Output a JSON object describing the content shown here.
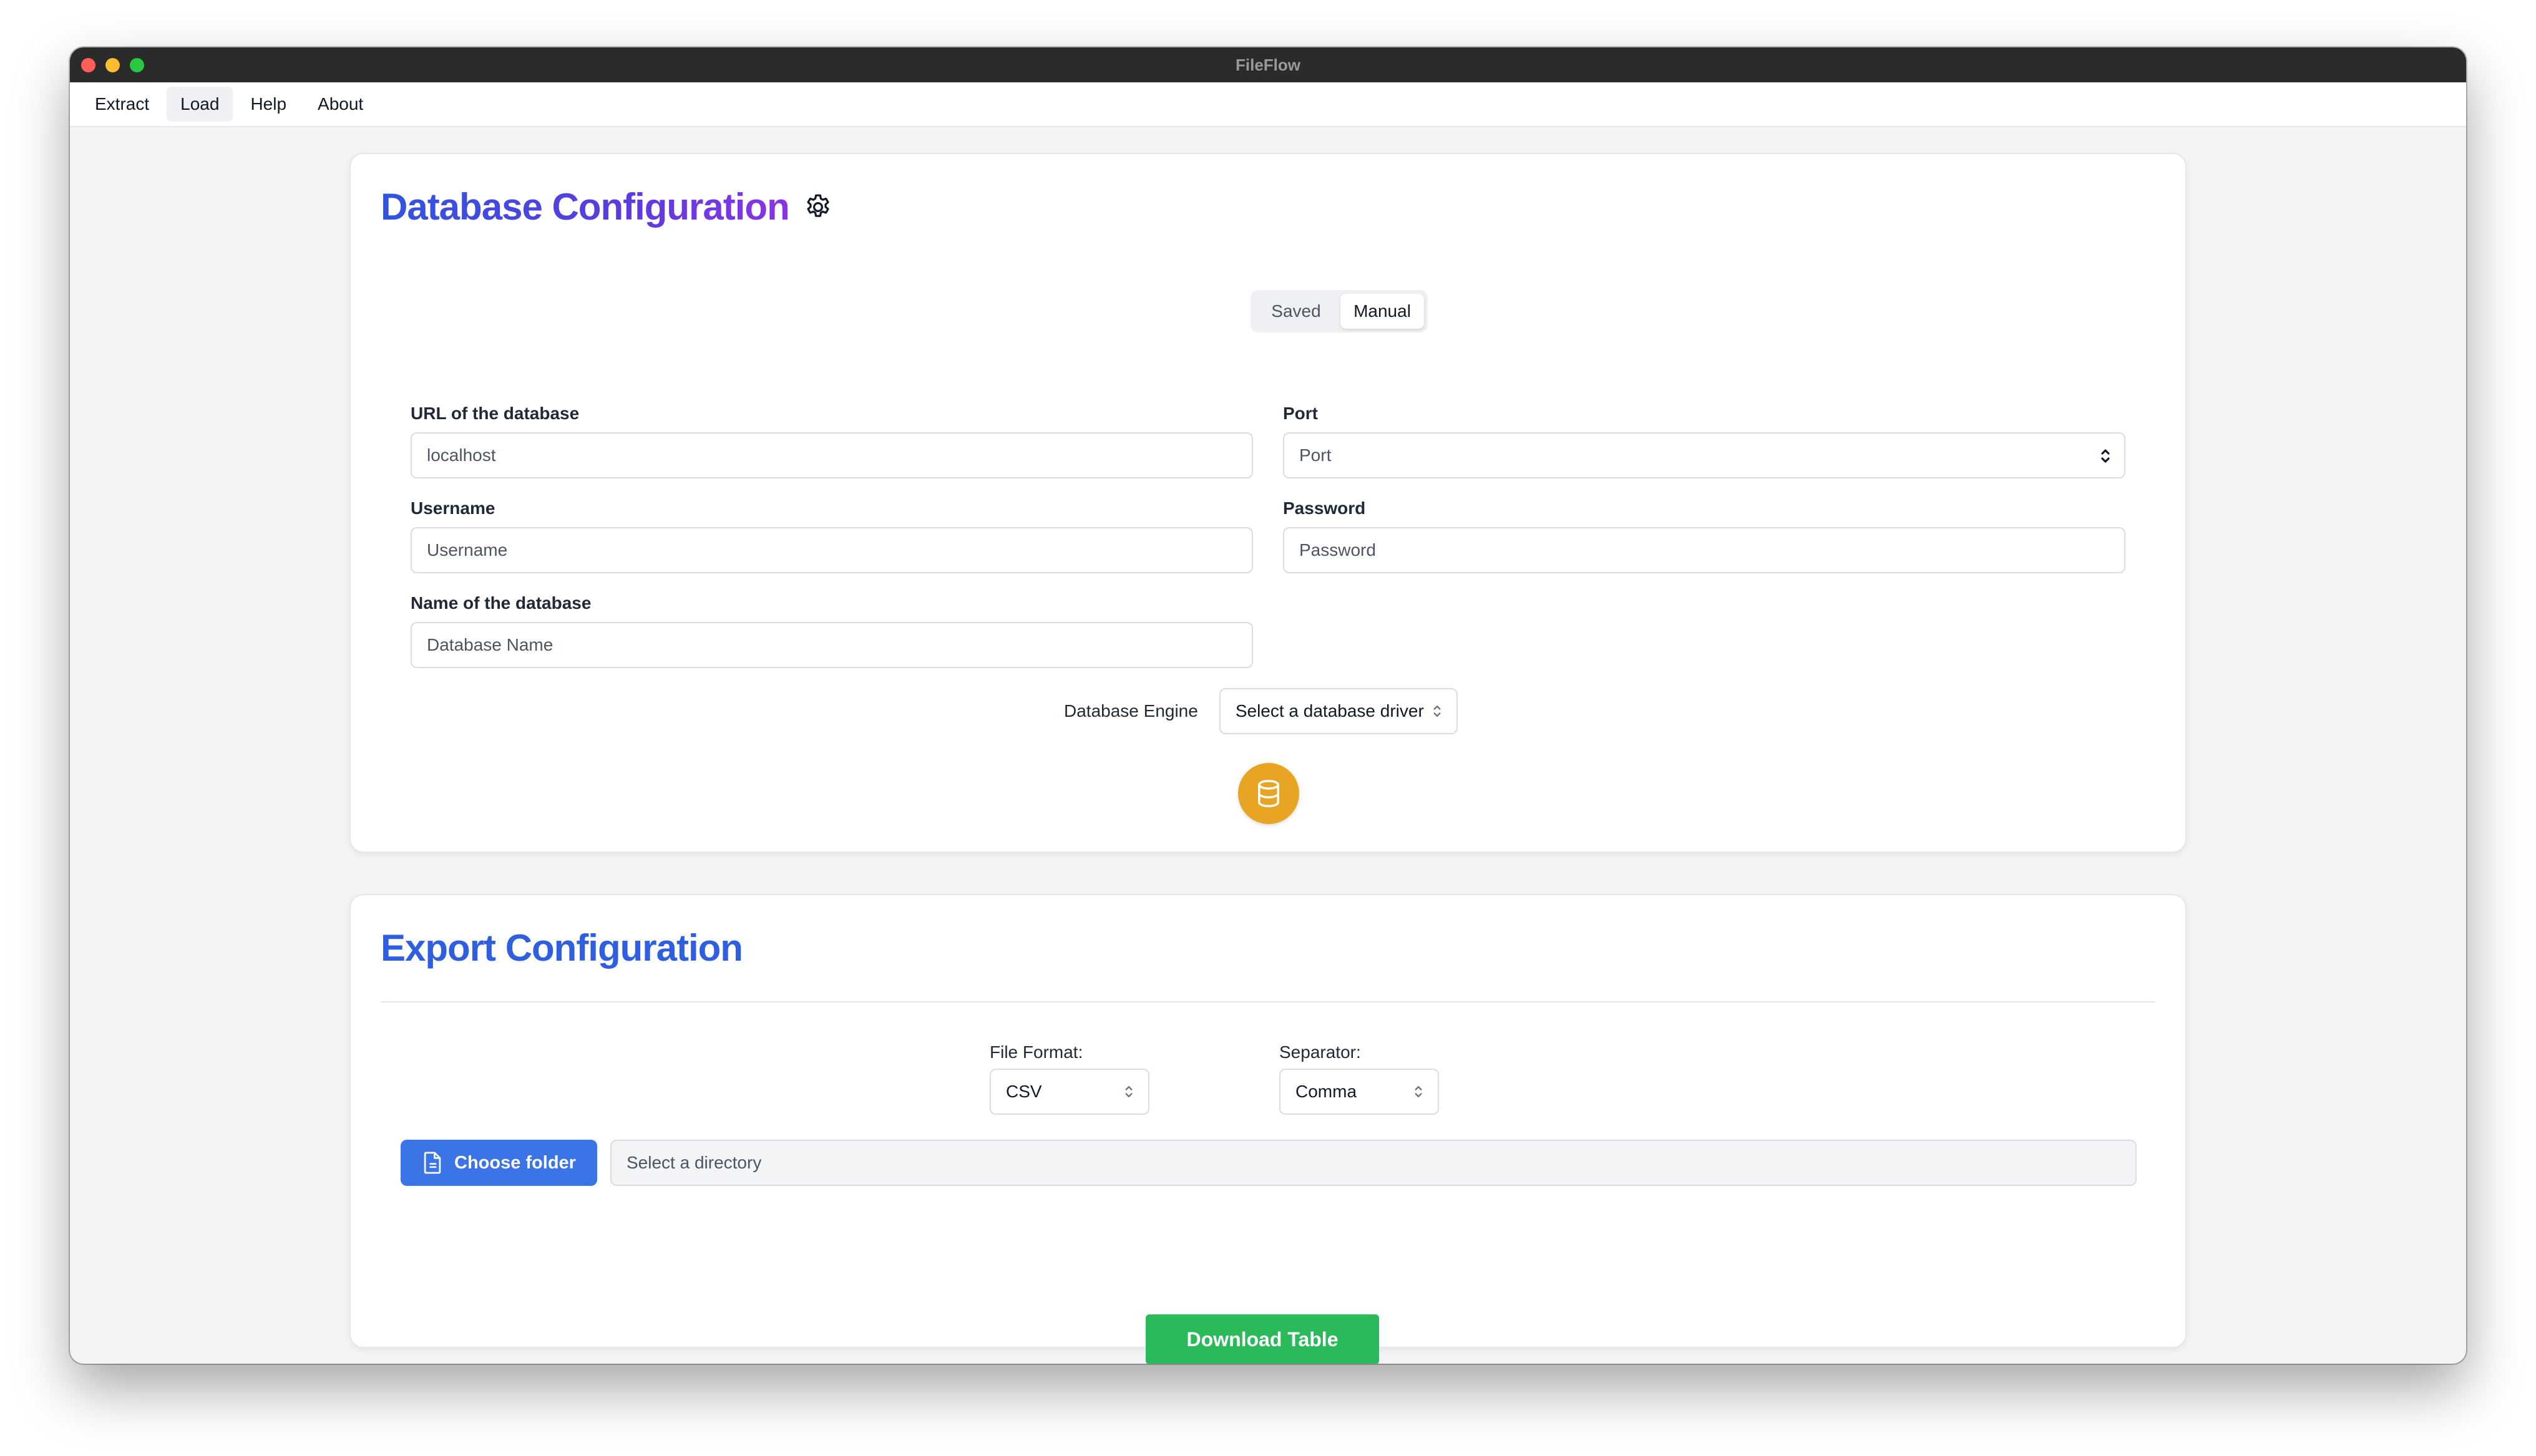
{
  "window": {
    "title": "FileFlow"
  },
  "menu": {
    "items": [
      {
        "label": "Extract"
      },
      {
        "label": "Load",
        "active": true
      },
      {
        "label": "Help"
      },
      {
        "label": "About"
      }
    ]
  },
  "db_config": {
    "title": "Database Configuration",
    "icon": "gear-icon",
    "mode_toggle": {
      "options": [
        "Saved",
        "Manual"
      ],
      "selected": "Manual"
    },
    "fields": {
      "url": {
        "label": "URL of the database",
        "value": "localhost"
      },
      "port": {
        "label": "Port",
        "placeholder": "Port"
      },
      "username": {
        "label": "Username",
        "placeholder": "Username"
      },
      "password": {
        "label": "Password",
        "placeholder": "Password"
      },
      "dbname": {
        "label": "Name of the database",
        "placeholder": "Database Name"
      }
    },
    "engine": {
      "label": "Database Engine",
      "selected": "Select a database driver"
    },
    "connect_icon": "database-icon"
  },
  "export_config": {
    "title": "Export Configuration",
    "file_format": {
      "label": "File Format:",
      "selected": "CSV"
    },
    "separator": {
      "label": "Separator:",
      "selected": "Comma"
    },
    "choose_folder": {
      "label": "Choose folder",
      "icon": "file-icon"
    },
    "directory": {
      "placeholder": "Select a directory"
    },
    "download": {
      "label": "Download Table"
    }
  },
  "colors": {
    "accent_blue": "#3b74e6",
    "download_green": "#2bba5a",
    "db_button_amber": "#e8a524",
    "title_gradient": [
      "#2f55e0",
      "#8a34e6"
    ]
  }
}
